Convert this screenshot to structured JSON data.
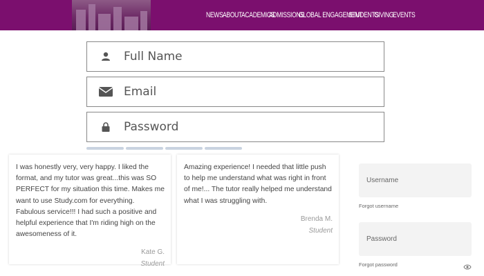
{
  "header": {
    "nav": [
      "NEWS",
      "ABOUT",
      "ACADEMICS",
      "ADMISSIONS",
      "GLOBAL ENGAGEMENT",
      "STUDENTS",
      "GIVING",
      "EVENTS"
    ],
    "colors": {
      "brand": "#7b0f6e"
    }
  },
  "form": {
    "name_placeholder": "Full Name",
    "email_placeholder": "Email",
    "password_placeholder": "Password",
    "icons": [
      "user-icon",
      "envelope-icon",
      "lock-icon"
    ]
  },
  "testimonials": [
    {
      "quote": "I was honestly very, very happy. I liked the format, and my tutor was great...this was SO PERFECT for my situation this time. Makes me want to use Study.com for everything. Fabulous service!!! I had such a positive and helpful experience that I'm riding high on the awesomeness of it.",
      "author": "Kate G.",
      "role": "Student"
    },
    {
      "quote": "Amazing experience! I needed that little push to help me understand what was right in front of me!... The tutor really helped me understand what I was struggling with.",
      "author": "Brenda M.",
      "role": "Student"
    }
  ],
  "login": {
    "username_placeholder": "Username",
    "forgot_username": "Forgot username",
    "password_placeholder": "Password",
    "forgot_password": "Forgot password"
  }
}
